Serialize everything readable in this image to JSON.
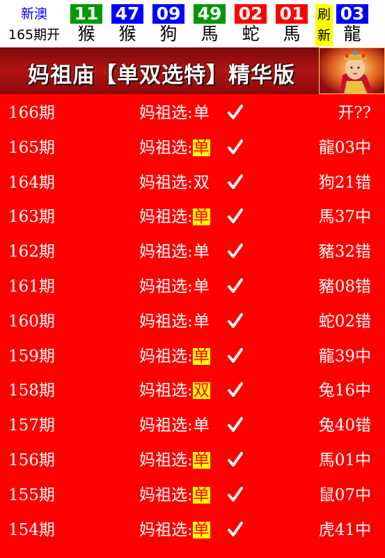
{
  "header": {
    "region": "新澳",
    "period_label": "165期开",
    "balls": [
      {
        "number": "11",
        "zodiac": "猴",
        "color": "#009900"
      },
      {
        "number": "47",
        "zodiac": "猴",
        "color": "#0000ff"
      },
      {
        "number": "09",
        "zodiac": "狗",
        "color": "#0000ff"
      },
      {
        "number": "49",
        "zodiac": "馬",
        "color": "#009900"
      },
      {
        "number": "02",
        "zodiac": "蛇",
        "color": "#ff0000"
      },
      {
        "number": "01",
        "zodiac": "馬",
        "color": "#ff0000"
      }
    ],
    "refresh": {
      "top": "刷",
      "bottom": "新"
    },
    "special_ball": {
      "number": "03",
      "zodiac": "龍",
      "color": "#0000ff"
    }
  },
  "banner": {
    "title": "妈祖庙【单双选特】精华版"
  },
  "pick_prefix": "妈祖选:",
  "rows": [
    {
      "period": "166期",
      "pick": "单",
      "highlight": false,
      "result": "开??"
    },
    {
      "period": "165期",
      "pick": "单",
      "highlight": true,
      "result": "龍03中"
    },
    {
      "period": "164期",
      "pick": "双",
      "highlight": false,
      "result": "狗21错"
    },
    {
      "period": "163期",
      "pick": "单",
      "highlight": true,
      "result": "馬37中"
    },
    {
      "period": "162期",
      "pick": "单",
      "highlight": false,
      "result": "豬32错"
    },
    {
      "period": "161期",
      "pick": "单",
      "highlight": false,
      "result": "豬08错"
    },
    {
      "period": "160期",
      "pick": "单",
      "highlight": false,
      "result": "蛇02错"
    },
    {
      "period": "159期",
      "pick": "单",
      "highlight": true,
      "result": "龍39中"
    },
    {
      "period": "158期",
      "pick": "双",
      "highlight": true,
      "result": "兔16中"
    },
    {
      "period": "157期",
      "pick": "单",
      "highlight": false,
      "result": "兔40错"
    },
    {
      "period": "156期",
      "pick": "单",
      "highlight": true,
      "result": "馬01中"
    },
    {
      "period": "155期",
      "pick": "单",
      "highlight": true,
      "result": "鼠07中"
    },
    {
      "period": "154期",
      "pick": "单",
      "highlight": true,
      "result": "虎41中"
    }
  ]
}
